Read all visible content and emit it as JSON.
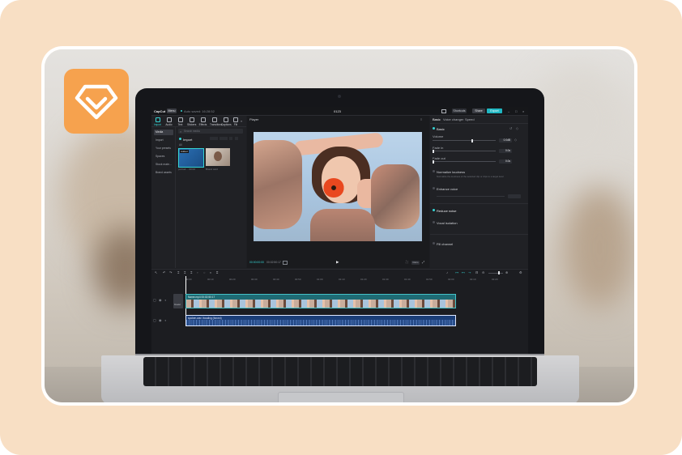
{
  "editor": {
    "app_name": "CapCut",
    "menu_label": "Menu",
    "autosave_text": "Auto saved: 16:28:52",
    "project_title": "0123",
    "shortcuts_label": "Shortcuts",
    "share_label": "Share",
    "export_label": "Export",
    "toolbar": [
      {
        "label": "Import"
      },
      {
        "label": "Audio"
      },
      {
        "label": "Text"
      },
      {
        "label": "Stickers"
      },
      {
        "label": "Effects"
      },
      {
        "label": "Transitions"
      },
      {
        "label": "Captions"
      },
      {
        "label": "Filt"
      }
    ],
    "sidebar": [
      {
        "label": "Media"
      },
      {
        "label": "Import"
      },
      {
        "label": "Your presets"
      },
      {
        "label": "Spaces"
      },
      {
        "label": "Stock mate..."
      },
      {
        "label": "Brand assets"
      }
    ],
    "media": {
      "search_placeholder": "Search media",
      "import_label": "Import",
      "filter_label": "All",
      "items": [
        {
          "badge": "Added",
          "caption": "portrait ... 00:02"
        },
        {
          "caption": "Brand card"
        }
      ]
    },
    "player": {
      "title": "Player",
      "time_current": "00:00:00:00",
      "time_total": "00:02:50:17",
      "ratio_label": "Ratio"
    },
    "properties": {
      "tabs": [
        {
          "label": "Basic"
        },
        {
          "label": "Voice changer"
        },
        {
          "label": "Speed"
        }
      ],
      "basic_heading": "Basic",
      "volume_label": "Volume",
      "volume_value": "0.0dB",
      "volume_level": 0.62,
      "fade_in_label": "Fade in",
      "fade_in_value": "0.0s",
      "fade_out_label": "Fade out",
      "fade_out_value": "0.0s",
      "normalize_label": "Normalize loudness",
      "normalize_desc": "Normalize the loudness of the selected clip or clips to a target level",
      "enhance_label": "Enhance voice",
      "reduce_noise_label": "Reduce noise",
      "vocal_isolation_label": "Vocal isolation",
      "fill_channel_label": "Fill channel"
    },
    "timeline": {
      "ticks": [
        "00:00",
        "00:10",
        "00:20",
        "00:30",
        "00:40",
        "00:50",
        "01:00",
        "01:10",
        "01:20",
        "01:30",
        "01:40",
        "01:50",
        "02:00",
        "02:10",
        "02:20"
      ],
      "video_clip_label": "Name.mp4  00:02:50:17",
      "audio_clip_label": "spoken.wav  Vocaling (forced)",
      "cover_label": "Cover"
    }
  },
  "colors": {
    "frame_bg": "#f8dfc4",
    "logo_orange": "#f6a24e",
    "accent_teal": "#36d3d3",
    "video_clip": "#1e6b74",
    "audio_clip": "#1c3f78"
  },
  "icons": {
    "logo": "diamond-icon"
  }
}
